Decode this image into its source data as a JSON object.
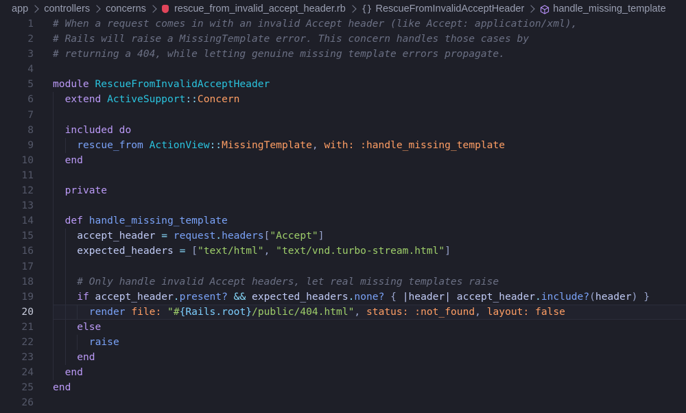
{
  "breadcrumb": {
    "segments": [
      "app",
      "controllers",
      "concerns"
    ],
    "file": "rescue_from_invalid_accept_header.rb",
    "module": "RescueFromInvalidAcceptHeader",
    "method": "handle_missing_template",
    "icons": [
      "ruby-file-icon",
      "braces-icon",
      "method-cube-icon",
      "chevron-right-icon"
    ]
  },
  "editor": {
    "language": "ruby",
    "current_line": 20,
    "lines": [
      {
        "n": "1",
        "indent": 0,
        "tokens": [
          [
            "comment",
            "# When a request comes in with an invalid Accept header (like Accept: application/xml),"
          ]
        ]
      },
      {
        "n": "2",
        "indent": 0,
        "tokens": [
          [
            "comment",
            "# Rails will raise a MissingTemplate error. This concern handles those cases by"
          ]
        ]
      },
      {
        "n": "3",
        "indent": 0,
        "tokens": [
          [
            "comment",
            "# returning a 404, while letting genuine missing template errors propagate."
          ]
        ]
      },
      {
        "n": "4",
        "indent": 0,
        "tokens": []
      },
      {
        "n": "5",
        "indent": 0,
        "tokens": [
          [
            "kw",
            "module "
          ],
          [
            "const",
            "RescueFromInvalidAcceptHeader"
          ]
        ]
      },
      {
        "n": "6",
        "indent": 1,
        "tokens": [
          [
            "kw",
            "extend "
          ],
          [
            "const",
            "ActiveSupport"
          ],
          [
            "op",
            "::"
          ],
          [
            "class",
            "Concern"
          ]
        ]
      },
      {
        "n": "7",
        "indent": 1,
        "tokens": []
      },
      {
        "n": "8",
        "indent": 1,
        "tokens": [
          [
            "kw",
            "included "
          ],
          [
            "kw",
            "do"
          ]
        ]
      },
      {
        "n": "9",
        "indent": 2,
        "tokens": [
          [
            "method",
            "rescue_from "
          ],
          [
            "const",
            "ActionView"
          ],
          [
            "op",
            "::"
          ],
          [
            "class",
            "MissingTemplate"
          ],
          [
            "punc",
            ", "
          ],
          [
            "sym",
            "with: :handle_missing_template"
          ]
        ]
      },
      {
        "n": "10",
        "indent": 1,
        "tokens": [
          [
            "kw",
            "end"
          ]
        ]
      },
      {
        "n": "11",
        "indent": 1,
        "tokens": []
      },
      {
        "n": "12",
        "indent": 1,
        "tokens": [
          [
            "kw",
            "private"
          ]
        ]
      },
      {
        "n": "13",
        "indent": 1,
        "tokens": []
      },
      {
        "n": "14",
        "indent": 1,
        "tokens": [
          [
            "kw",
            "def "
          ],
          [
            "method",
            "handle_missing_template"
          ]
        ]
      },
      {
        "n": "15",
        "indent": 2,
        "tokens": [
          [
            "var",
            "accept_header "
          ],
          [
            "op",
            "= "
          ],
          [
            "method",
            "request"
          ],
          [
            "op",
            "."
          ],
          [
            "method",
            "headers"
          ],
          [
            "punc",
            "["
          ],
          [
            "str",
            "\"Accept\""
          ],
          [
            "punc",
            "]"
          ]
        ]
      },
      {
        "n": "16",
        "indent": 2,
        "tokens": [
          [
            "var",
            "expected_headers "
          ],
          [
            "op",
            "= "
          ],
          [
            "punc",
            "["
          ],
          [
            "str",
            "\"text/html\""
          ],
          [
            "punc",
            ", "
          ],
          [
            "str",
            "\"text/vnd.turbo-stream.html\""
          ],
          [
            "punc",
            "]"
          ]
        ]
      },
      {
        "n": "17",
        "indent": 2,
        "tokens": []
      },
      {
        "n": "18",
        "indent": 2,
        "tokens": [
          [
            "comment",
            "# Only handle invalid Accept headers, let real missing templates raise"
          ]
        ]
      },
      {
        "n": "19",
        "indent": 2,
        "tokens": [
          [
            "kw",
            "if "
          ],
          [
            "var",
            "accept_header"
          ],
          [
            "op",
            "."
          ],
          [
            "method",
            "present?"
          ],
          [
            "op",
            " && "
          ],
          [
            "var",
            "expected_headers"
          ],
          [
            "op",
            "."
          ],
          [
            "method",
            "none?"
          ],
          [
            "punc",
            " { "
          ],
          [
            "var",
            "|header| accept_header"
          ],
          [
            "op",
            "."
          ],
          [
            "method",
            "include?"
          ],
          [
            "punc",
            "("
          ],
          [
            "var",
            "header"
          ],
          [
            "punc",
            ") }"
          ]
        ]
      },
      {
        "n": "20",
        "indent": 3,
        "tokens": [
          [
            "method",
            "render "
          ],
          [
            "sym",
            "file: "
          ],
          [
            "str",
            "\"#"
          ],
          [
            "interp",
            "{Rails.root}"
          ],
          [
            "str",
            "/public/404.html\""
          ],
          [
            "punc",
            ", "
          ],
          [
            "sym",
            "status: :not_found"
          ],
          [
            "punc",
            ", "
          ],
          [
            "sym",
            "layout: "
          ],
          [
            "class",
            "false"
          ]
        ]
      },
      {
        "n": "21",
        "indent": 2,
        "tokens": [
          [
            "kw",
            "else"
          ]
        ]
      },
      {
        "n": "22",
        "indent": 3,
        "tokens": [
          [
            "method",
            "raise"
          ]
        ]
      },
      {
        "n": "23",
        "indent": 2,
        "tokens": [
          [
            "kw",
            "end"
          ]
        ]
      },
      {
        "n": "24",
        "indent": 1,
        "tokens": [
          [
            "kw",
            "end"
          ]
        ]
      },
      {
        "n": "25",
        "indent": 0,
        "tokens": [
          [
            "kw",
            "end"
          ]
        ]
      },
      {
        "n": "26",
        "indent": 0,
        "tokens": []
      }
    ]
  },
  "theme": {
    "background": "#1e1f28",
    "comment": "#6b7084",
    "keyword": "#bb9af7",
    "constant": "#2ac3de",
    "string": "#9ece6a",
    "symbol": "#ff9e64"
  }
}
